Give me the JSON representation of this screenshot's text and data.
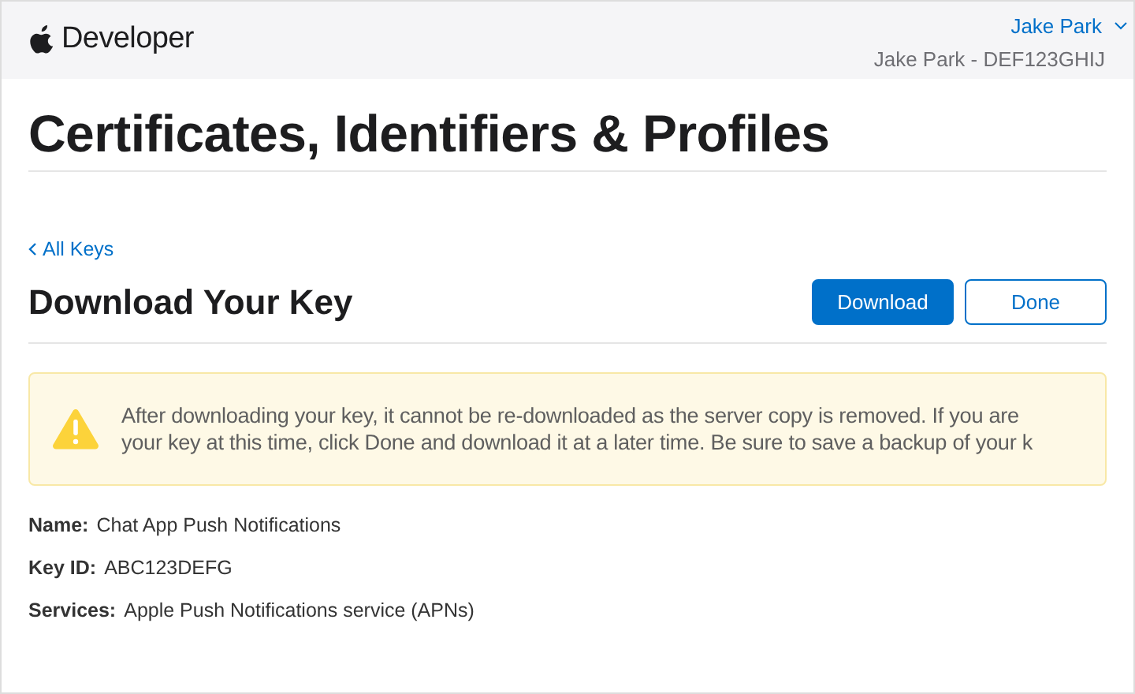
{
  "header": {
    "brand": "Developer",
    "account_name": "Jake Park",
    "account_team": "Jake Park - DEF123GHIJ"
  },
  "page_title": "Certificates, Identifiers & Profiles",
  "back_link": "All Keys",
  "section_title": "Download Your Key",
  "buttons": [
    {
      "label": "Download",
      "kind": "primary"
    },
    {
      "label": "Done",
      "kind": "secondary"
    }
  ],
  "warning": {
    "lines": [
      "After downloading your key, it cannot be re-downloaded as the server copy is removed. If you are",
      "your key at this time, click Done and download it at a later time. Be sure to save a backup of your k"
    ]
  },
  "details": [
    {
      "label": "Name:",
      "value": "Chat App Push Notifications"
    },
    {
      "label": "Key ID:",
      "value": "ABC123DEFG"
    },
    {
      "label": "Services:",
      "value": "Apple Push Notifications service (APNs)"
    }
  ]
}
